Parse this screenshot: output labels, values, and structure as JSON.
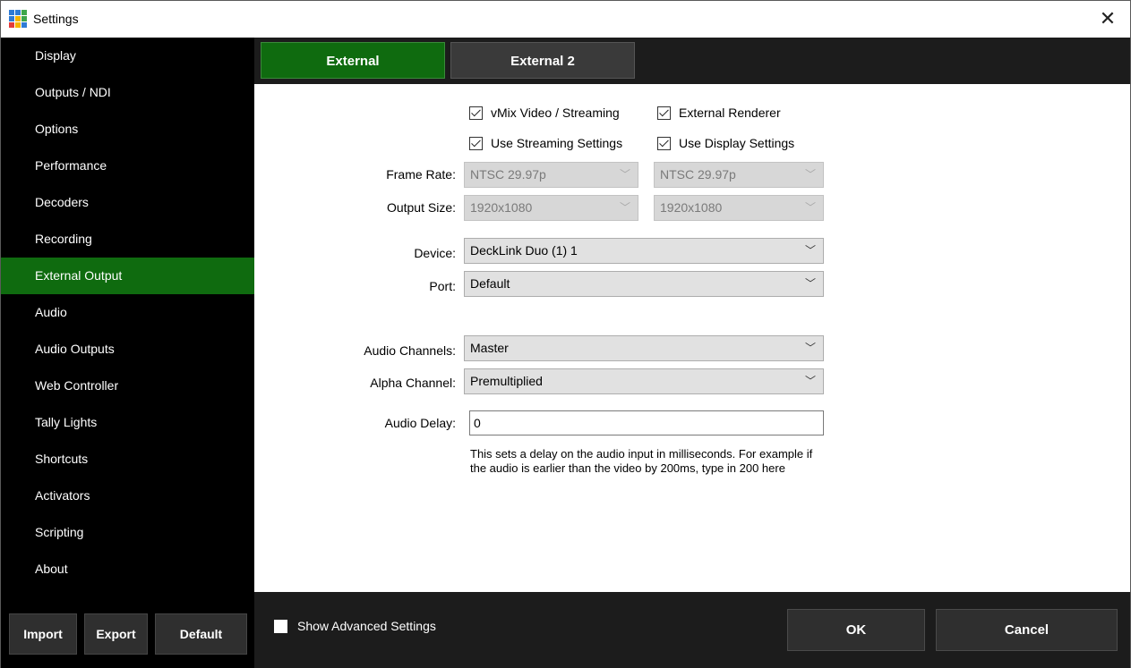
{
  "window": {
    "title": "Settings",
    "close_glyph": "✕"
  },
  "sidebar": {
    "items": [
      {
        "label": "Display"
      },
      {
        "label": "Outputs / NDI"
      },
      {
        "label": "Options"
      },
      {
        "label": "Performance"
      },
      {
        "label": "Decoders"
      },
      {
        "label": "Recording"
      },
      {
        "label": "External Output",
        "active": true
      },
      {
        "label": "Audio"
      },
      {
        "label": "Audio Outputs"
      },
      {
        "label": "Web Controller"
      },
      {
        "label": "Tally Lights"
      },
      {
        "label": "Shortcuts"
      },
      {
        "label": "Activators"
      },
      {
        "label": "Scripting"
      },
      {
        "label": "About"
      }
    ],
    "buttons": {
      "import": "Import",
      "export": "Export",
      "default": "Default"
    }
  },
  "tabs": [
    {
      "label": "External",
      "active": true
    },
    {
      "label": "External 2",
      "active": false
    }
  ],
  "form": {
    "checks": {
      "vmix_video": {
        "label": "vMix Video / Streaming",
        "checked": true
      },
      "external_renderer": {
        "label": "External Renderer",
        "checked": true
      },
      "use_streaming": {
        "label": "Use Streaming Settings",
        "checked": true
      },
      "use_display": {
        "label": "Use Display Settings",
        "checked": true
      }
    },
    "frame_rate": {
      "label": "Frame Rate:",
      "value1": "NTSC 29.97p",
      "value2": "NTSC 29.97p"
    },
    "output_size": {
      "label": "Output Size:",
      "value1": "1920x1080",
      "value2": "1920x1080"
    },
    "device": {
      "label": "Device:",
      "value": "DeckLink Duo (1) 1"
    },
    "port": {
      "label": "Port:",
      "value": "Default"
    },
    "audio_channels": {
      "label": "Audio Channels:",
      "value": "Master"
    },
    "alpha_channel": {
      "label": "Alpha Channel:",
      "value": "Premultiplied"
    },
    "audio_delay": {
      "label": "Audio Delay:",
      "value": "0"
    },
    "help_line1": "This sets a delay on the audio input in milliseconds. For example if",
    "help_line2": "the audio is earlier than the video by 200ms, type in 200 here"
  },
  "footer": {
    "show_advanced": {
      "label": "Show Advanced Settings",
      "checked": false
    },
    "ok": "OK",
    "cancel": "Cancel"
  },
  "colors": {
    "accent_green": "#0f6b0f",
    "sidebar_bg": "#000000",
    "bar_bg": "#1c1c1c",
    "app_icon": [
      "#2e7bd6",
      "#f5b400",
      "#3da64a",
      "#e23b3b"
    ]
  },
  "icons": {
    "app": "vmix-grid-icon",
    "close": "close-icon",
    "chevron": "chevron-down-icon",
    "check": "checkmark-icon"
  }
}
